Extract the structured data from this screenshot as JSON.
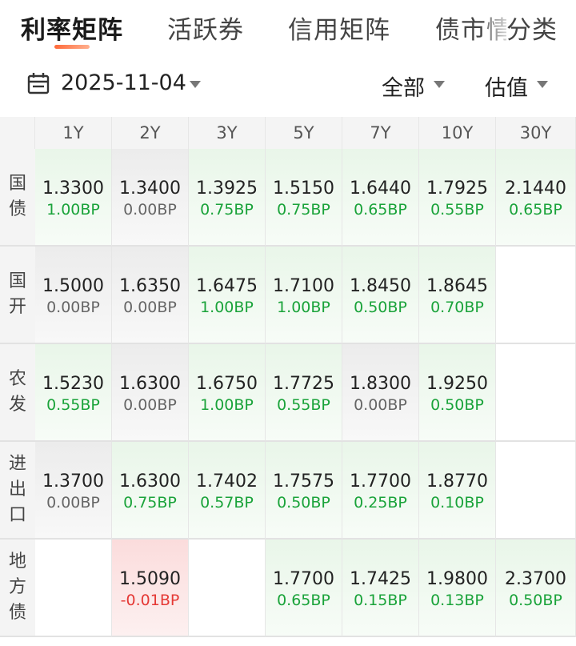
{
  "tabs": [
    {
      "label": "利率矩阵",
      "active": true
    },
    {
      "label": "活跃券",
      "active": false
    },
    {
      "label": "信用矩阵",
      "active": false
    },
    {
      "label": "债市情绪",
      "active": false
    },
    {
      "label": "分类",
      "active": false
    }
  ],
  "filters": {
    "date": "2025-11-04",
    "scope": "全部",
    "metric": "估值"
  },
  "colors": {
    "up": "#1aa33a",
    "flat": "#666666",
    "down": "#e53935",
    "accent": "#ff6a3a"
  },
  "matrix": {
    "tenors": [
      "1Y",
      "2Y",
      "3Y",
      "5Y",
      "7Y",
      "10Y",
      "30Y"
    ],
    "rows": [
      {
        "label": [
          "国",
          "债"
        ],
        "cells": [
          {
            "rate": "1.3300",
            "change": "1.00BP",
            "trend": "up"
          },
          {
            "rate": "1.3400",
            "change": "0.00BP",
            "trend": "flat"
          },
          {
            "rate": "1.3925",
            "change": "0.75BP",
            "trend": "up"
          },
          {
            "rate": "1.5150",
            "change": "0.75BP",
            "trend": "up"
          },
          {
            "rate": "1.6440",
            "change": "0.65BP",
            "trend": "up"
          },
          {
            "rate": "1.7925",
            "change": "0.55BP",
            "trend": "up"
          },
          {
            "rate": "2.1440",
            "change": "0.65BP",
            "trend": "up"
          }
        ]
      },
      {
        "label": [
          "国",
          "开"
        ],
        "cells": [
          {
            "rate": "1.5000",
            "change": "0.00BP",
            "trend": "flat"
          },
          {
            "rate": "1.6350",
            "change": "0.00BP",
            "trend": "flat"
          },
          {
            "rate": "1.6475",
            "change": "1.00BP",
            "trend": "up"
          },
          {
            "rate": "1.7100",
            "change": "1.00BP",
            "trend": "up"
          },
          {
            "rate": "1.8450",
            "change": "0.50BP",
            "trend": "up"
          },
          {
            "rate": "1.8645",
            "change": "0.70BP",
            "trend": "up"
          },
          null
        ]
      },
      {
        "label": [
          "农",
          "发"
        ],
        "cells": [
          {
            "rate": "1.5230",
            "change": "0.55BP",
            "trend": "up"
          },
          {
            "rate": "1.6300",
            "change": "0.00BP",
            "trend": "flat"
          },
          {
            "rate": "1.6750",
            "change": "1.00BP",
            "trend": "up"
          },
          {
            "rate": "1.7725",
            "change": "0.55BP",
            "trend": "up"
          },
          {
            "rate": "1.8300",
            "change": "0.00BP",
            "trend": "flat"
          },
          {
            "rate": "1.9250",
            "change": "0.50BP",
            "trend": "up"
          },
          null
        ]
      },
      {
        "label": [
          "进",
          "出",
          "口"
        ],
        "cells": [
          {
            "rate": "1.3700",
            "change": "0.00BP",
            "trend": "flat"
          },
          {
            "rate": "1.6300",
            "change": "0.75BP",
            "trend": "up"
          },
          {
            "rate": "1.7402",
            "change": "0.57BP",
            "trend": "up"
          },
          {
            "rate": "1.7575",
            "change": "0.50BP",
            "trend": "up"
          },
          {
            "rate": "1.7700",
            "change": "0.25BP",
            "trend": "up"
          },
          {
            "rate": "1.8770",
            "change": "0.10BP",
            "trend": "up"
          },
          null
        ]
      },
      {
        "label": [
          "地",
          "方",
          "债"
        ],
        "cells": [
          null,
          {
            "rate": "1.5090",
            "change": "-0.01BP",
            "trend": "down"
          },
          null,
          {
            "rate": "1.7700",
            "change": "0.65BP",
            "trend": "up"
          },
          {
            "rate": "1.7425",
            "change": "0.15BP",
            "trend": "up"
          },
          {
            "rate": "1.9800",
            "change": "0.13BP",
            "trend": "up"
          },
          {
            "rate": "2.3700",
            "change": "0.50BP",
            "trend": "up"
          }
        ]
      }
    ]
  }
}
